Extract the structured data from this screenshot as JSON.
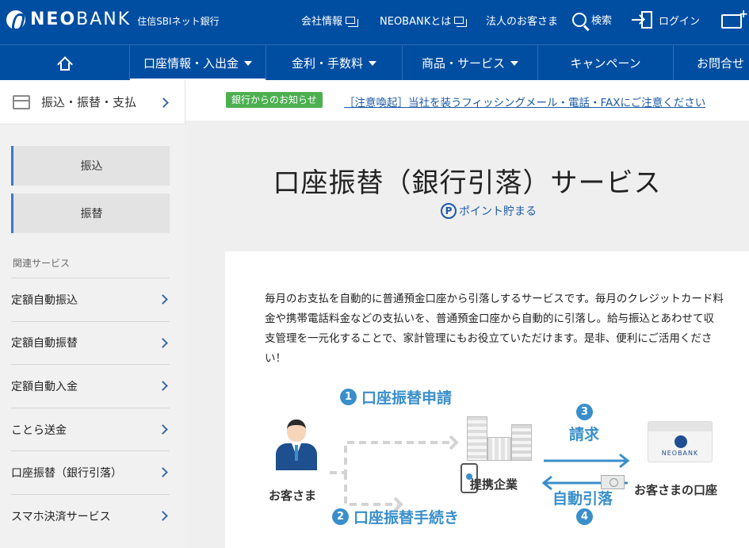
{
  "header": {
    "brand_bold": "NEO",
    "brand_light": "BANK",
    "brand_sub": "住信SBIネット銀行",
    "links": [
      {
        "label": "会社情報"
      },
      {
        "label": "NEOBANKとは"
      },
      {
        "label": "法人のお客さま"
      }
    ],
    "search_label": "検索",
    "login_label": "ログイン"
  },
  "gnav": {
    "items": [
      {
        "label": "口座情報・入出金"
      },
      {
        "label": "金利・手数料"
      },
      {
        "label": "商品・サービス"
      },
      {
        "label": "キャンペーン"
      },
      {
        "label": "お問合せ"
      }
    ]
  },
  "sidebar": {
    "section_title": "振込・振替・支払",
    "sub_items": [
      "振込",
      "振替"
    ],
    "related_title": "関連サービス",
    "related_items": [
      "定額自動振込",
      "定額自動振替",
      "定額自動入金",
      "ことら送金",
      "口座振替（銀行引落）",
      "スマホ決済サービス"
    ]
  },
  "notice": {
    "badge": "銀行からのお知らせ",
    "link": "［注意喚起］当社を装うフィッシングメール・電話・FAXにご注意ください"
  },
  "page": {
    "title": "口座振替（銀行引落）サービス",
    "points_label": "ポイント貯まる",
    "points_icon_letter": "P",
    "description": "毎月のお支払を自動的に普通預金口座から引落しするサービスです。毎月のクレジットカード料金や携帯電話料金などの支払いを、普通預金口座から自動的に引落し。給与振込とあわせて収支管理を一元化することで、家計管理にもお役立ていただけます。是非、便利にご活用ください！"
  },
  "diagram": {
    "step1_num": "1",
    "step1": "口座振替申請",
    "step2_num": "2",
    "step2": "口座振替手続き",
    "step3_num": "3",
    "step3": "請求",
    "step4_num": "4",
    "step4": "自動引落",
    "customer": "お客さま",
    "company": "提携企業",
    "account": "お客さまの口座",
    "bank_card_text": "NEOBANK"
  },
  "colors": {
    "brand_blue": "#004ea2",
    "diagram_blue": "#3a8fcb",
    "notice_green": "#4caf50",
    "link_blue": "#1c5aa8"
  }
}
